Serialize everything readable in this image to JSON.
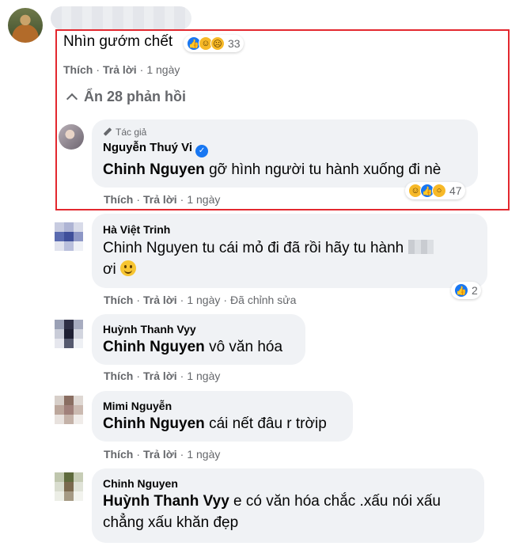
{
  "top_comment": {
    "text": "Nhìn gướm chết",
    "reaction_count": "33",
    "reaction_icons": [
      "like-reaction-icon",
      "haha-reaction-icon",
      "sad-reaction-icon"
    ],
    "actions": {
      "like": "Thích",
      "reply": "Trả lời",
      "time": "1 ngày"
    }
  },
  "hide_replies": {
    "label": "Ẩn 28 phản hồi"
  },
  "replies": [
    {
      "badge": "Tác giả",
      "author": "Nguyễn Thuý Vi",
      "mention": "Chinh Nguyen",
      "text": "gỡ hình người tu hành xuống đi nè",
      "reaction_count": "47",
      "actions": {
        "like": "Thích",
        "reply": "Trả lời",
        "time": "1 ngày"
      }
    },
    {
      "author": "Hà Việt Trinh",
      "mention": "Chinh Nguyen",
      "text": "tu cái mỏ đi đã rồi hãy tu hành",
      "text_line2": "ơi",
      "reaction_count": "2",
      "actions": {
        "like": "Thích",
        "reply": "Trả lời",
        "time": "1 ngày",
        "edited": "Đã chỉnh sửa"
      }
    },
    {
      "author": "Huỳnh Thanh Vyy",
      "mention": "Chinh Nguyen",
      "text": "vô văn hóa",
      "actions": {
        "like": "Thích",
        "reply": "Trả lời",
        "time": "1 ngày"
      }
    },
    {
      "author": "Mimi Nguyễn",
      "mention": "Chinh Nguyen",
      "text": "cái nết đâu r trờip",
      "actions": {
        "like": "Thích",
        "reply": "Trả lời",
        "time": "1 ngày"
      }
    },
    {
      "author": "Chinh Nguyen",
      "mention": "Huỳnh Thanh Vyy",
      "text": "e có văn hóa chắc .xấu nói xấu",
      "text_line2": "chẳng xấu khăn đẹp"
    }
  ],
  "colors": {
    "highlight": "#e3282f",
    "bubble": "#f0f2f5",
    "meta": "#65676b",
    "like_blue": "#1877f2"
  }
}
